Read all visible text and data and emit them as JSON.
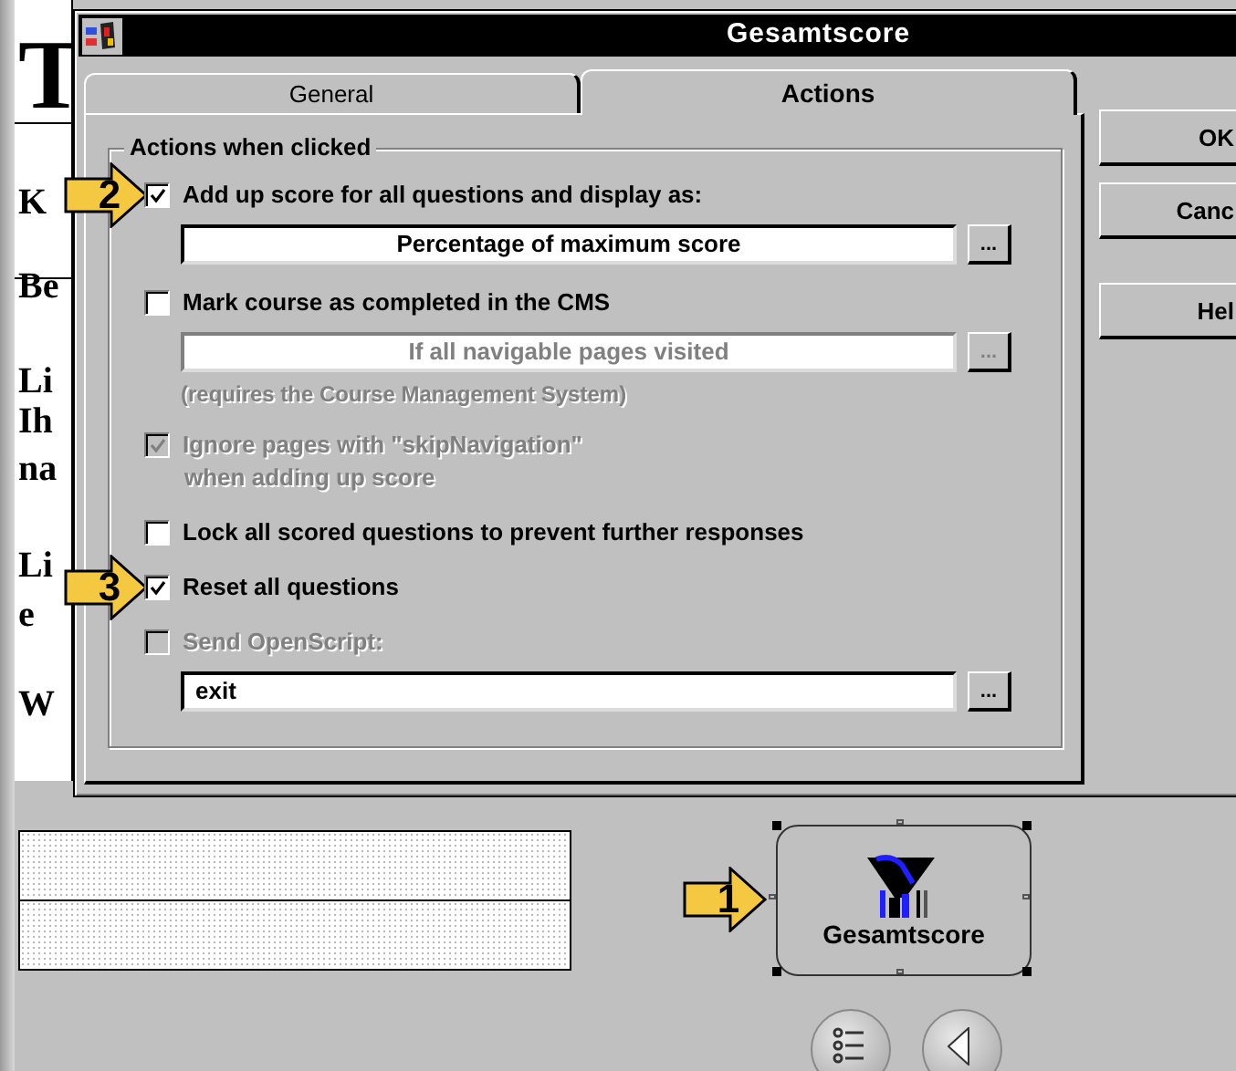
{
  "background_page": {
    "fragments": [
      "T",
      "K",
      "Be",
      "Li",
      "Ih",
      "na",
      "Li",
      "e",
      "W"
    ]
  },
  "dialog": {
    "title": "Gesamtscore",
    "tabs": [
      {
        "label": "General",
        "selected": false
      },
      {
        "label": "Actions",
        "selected": true
      }
    ],
    "group": {
      "legend": "Actions when clicked",
      "items": [
        {
          "kind": "checkbox",
          "lines": [
            "Add up score for all questions and display as:"
          ],
          "checked": true,
          "disabled": false,
          "callout": "2"
        },
        {
          "kind": "field",
          "value": "Percentage of maximum score",
          "disabled": false,
          "button": "..."
        },
        {
          "kind": "checkbox",
          "lines": [
            "Mark course as completed in the CMS"
          ],
          "checked": false,
          "disabled": false
        },
        {
          "kind": "field",
          "value": "If all navigable pages visited",
          "disabled": true,
          "button": "..."
        },
        {
          "kind": "note",
          "text": "(requires the Course Management System)",
          "disabled": true
        },
        {
          "kind": "checkbox",
          "lines": [
            "Ignore pages with \"skipNavigation\"",
            "when adding up score"
          ],
          "checked": true,
          "disabled": true
        },
        {
          "kind": "checkbox",
          "lines": [
            "Lock all scored questions to prevent further responses"
          ],
          "checked": false,
          "disabled": false
        },
        {
          "kind": "checkbox",
          "lines": [
            "Reset all questions"
          ],
          "checked": true,
          "disabled": false,
          "callout": "3"
        },
        {
          "kind": "checkbox",
          "lines": [
            "Send OpenScript:"
          ],
          "checked": false,
          "disabled": true
        },
        {
          "kind": "script-field",
          "value": "exit",
          "disabled": false,
          "button": "..."
        }
      ]
    },
    "buttons": [
      "OK",
      "Canc",
      "Hel"
    ]
  },
  "canvas": {
    "button": {
      "label": "Gesamtscore",
      "selected": true,
      "callout": "1"
    }
  }
}
